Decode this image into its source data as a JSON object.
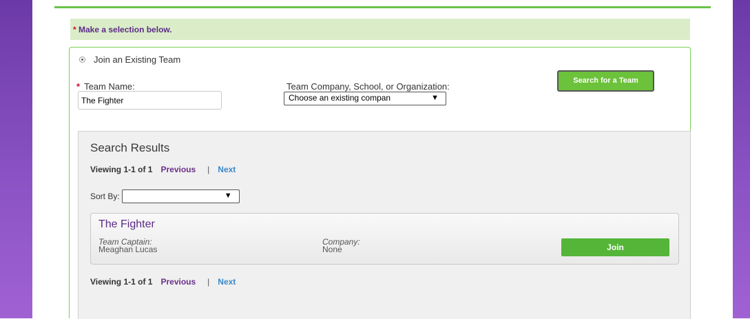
{
  "colors": {
    "accent_green": "#6cc24a",
    "side_purple": "#8a52c4",
    "title_purple": "#5b2a86",
    "link_blue": "#3a87c9"
  },
  "notice": {
    "star": "*",
    "text": "Make a selection below."
  },
  "join_option": {
    "label": "Join an Existing Team",
    "selected": true
  },
  "form": {
    "required_star": "*",
    "team_name_label": "Team Name:",
    "team_name_value": "The Fighter",
    "company_label": "Team Company, School, or Organization:",
    "company_selected": "Choose an existing compan",
    "search_button": "Search for a Team"
  },
  "results": {
    "title": "Search Results",
    "pager_top": {
      "viewing": "Viewing 1-1 of 1",
      "previous": "Previous",
      "separator": "|",
      "next": "Next"
    },
    "sort_label": "Sort By:",
    "sort_selected": "",
    "items": [
      {
        "team_name": "The Fighter",
        "captain_label": "Team Captain:",
        "captain_value": "Meaghan Lucas",
        "company_label": "Company:",
        "company_value": "None",
        "join_label": "Join"
      }
    ],
    "pager_bottom": {
      "viewing": "Viewing 1-1 of 1",
      "previous": "Previous",
      "separator": "|",
      "next": "Next"
    }
  }
}
